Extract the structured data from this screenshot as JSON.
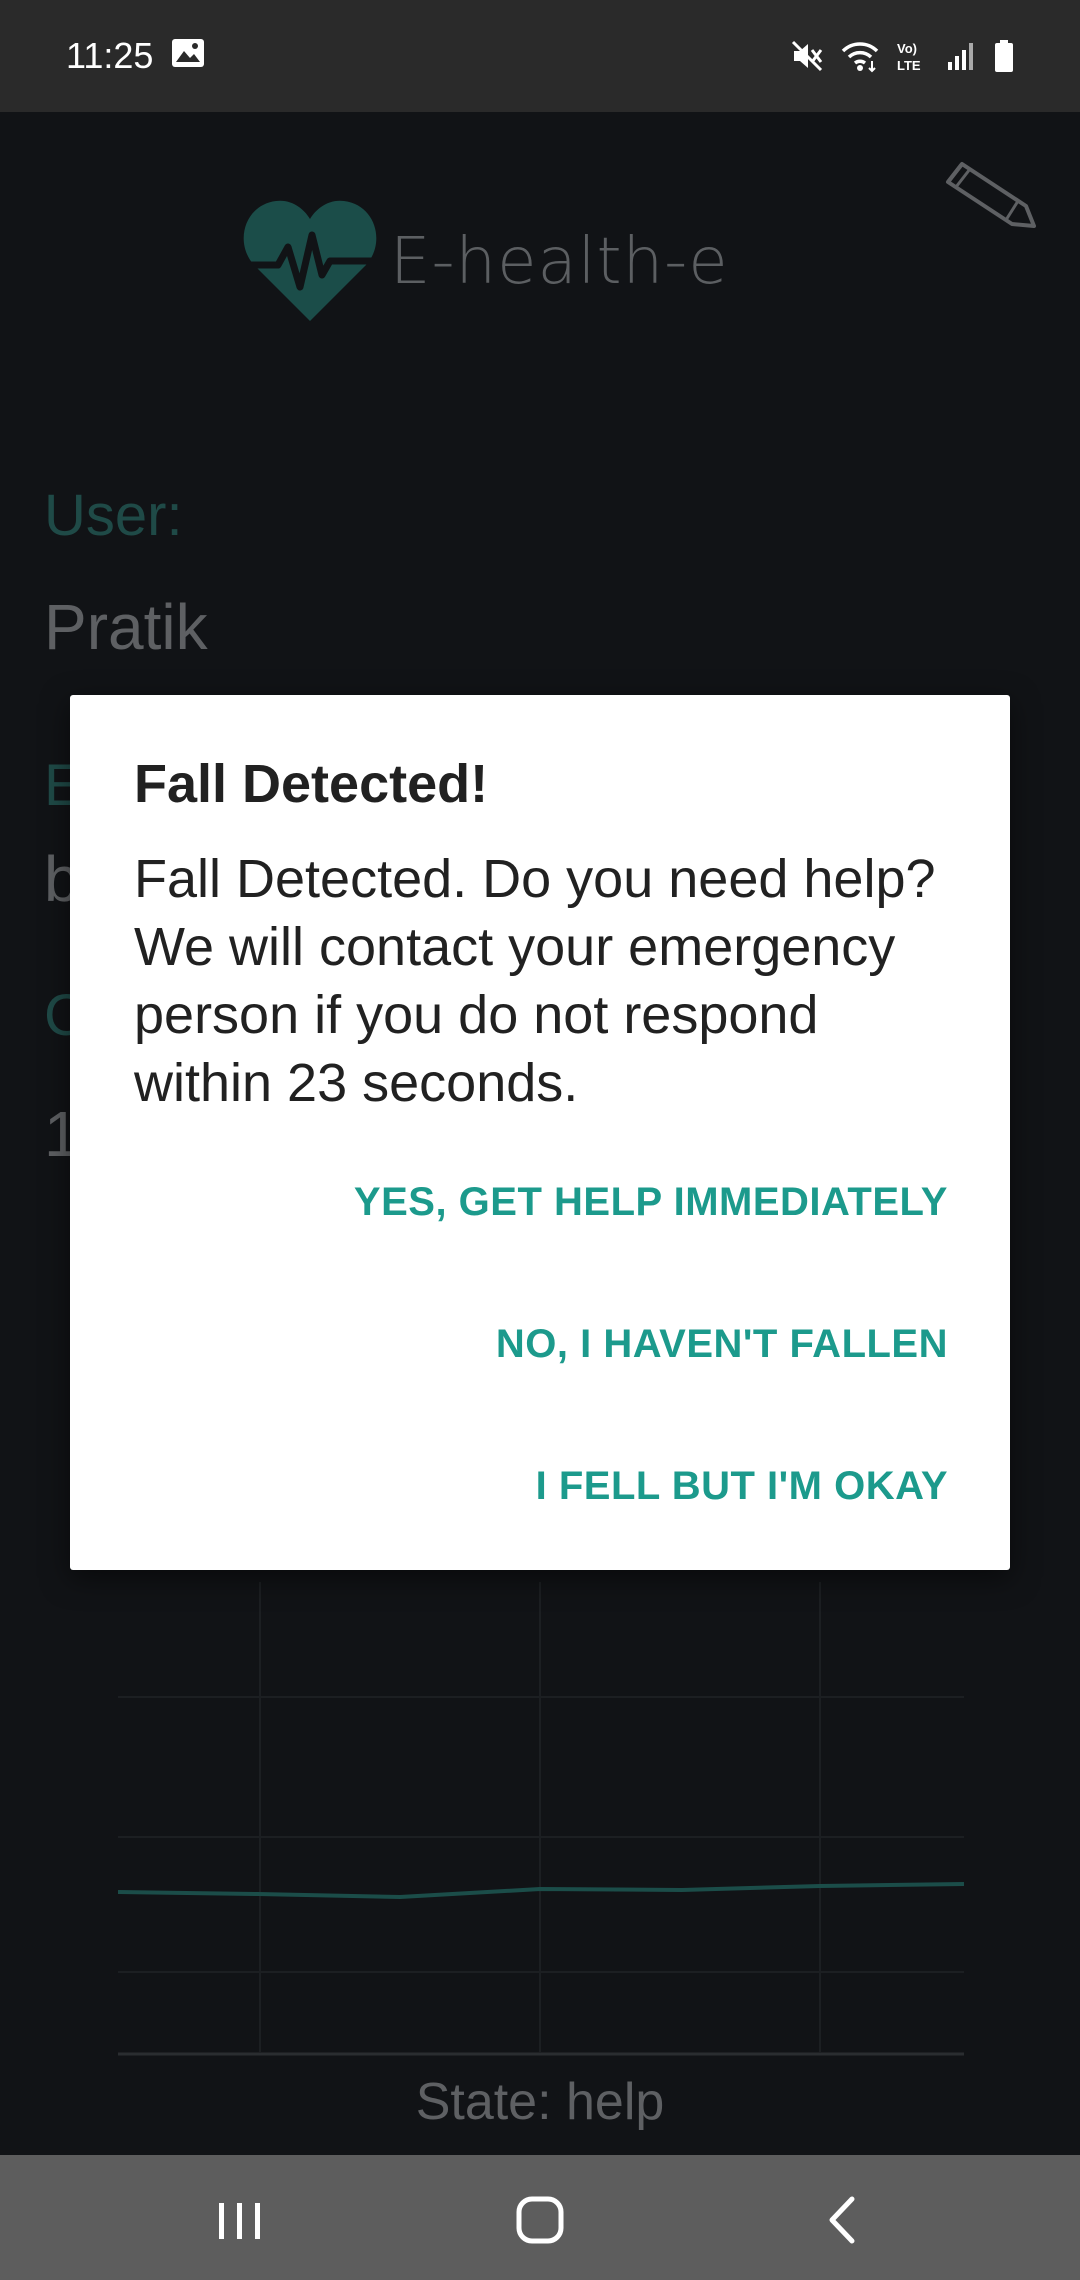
{
  "status_bar": {
    "time": "11:25",
    "icons": [
      "image-notification-icon",
      "mute-icon",
      "wifi-icon",
      "volte-icon",
      "signal-icon",
      "battery-icon"
    ],
    "volte_label": "Vo) LTE"
  },
  "app": {
    "logo_text": "E-health-e",
    "user_label": "User:",
    "user_value": "Pratik",
    "partial_label_1": "E",
    "partial_value_1": "b",
    "partial_label_2": "C",
    "partial_value_2": "1",
    "state_text": "State: help",
    "accent_color": "#1f4a47"
  },
  "dialog": {
    "title": "Fall Detected!",
    "message": "Fall Detected. Do you need help? We will contact your emergency person if you do not respond within 23 seconds.",
    "buttons": {
      "yes": "YES, GET HELP IMMEDIATELY",
      "no": "NO, I HAVEN'T FALLEN",
      "okay": "I FELL BUT I'M OKAY"
    },
    "button_color": "#1c9a8c"
  },
  "nav_bar": {
    "items": [
      "recent-apps-icon",
      "home-icon",
      "back-icon"
    ]
  }
}
